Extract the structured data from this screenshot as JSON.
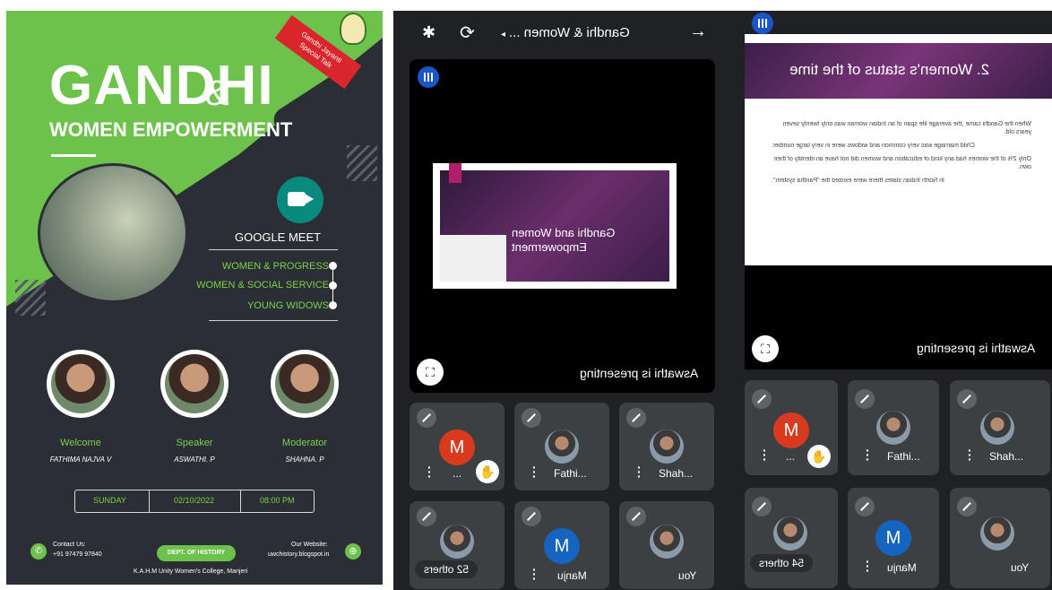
{
  "poster": {
    "title_line1": "GANDHI",
    "title_amp": "&",
    "title_line2": "WOMEN EMPOWERMENT",
    "tag_line1": "Gandhi Jayanti",
    "tag_line2": "Special Talk",
    "platform": "GOOGLE MEET",
    "topics": [
      "WOMEN & PROGRESS",
      "WOMEN & SOCIAL SERVICE",
      "YOUNG WIDOWS"
    ],
    "people": [
      {
        "role": "Welcome",
        "name": "FATHIMA NAJVA V"
      },
      {
        "role": "Speaker",
        "name": "ASWATHI. P"
      },
      {
        "role": "Moderator",
        "name": "SHAHNA. P"
      }
    ],
    "day": "SUNDAY",
    "date": "02/10/2022",
    "time": "08:00 PM",
    "contact_label": "Contact Us:",
    "contact_phone": "+91 97479 97840",
    "dept_badge": "DEPT. OF HISTORY",
    "website_label": "Our Website:",
    "website": "uwchistory.blogspot.in",
    "college": "K.A.H.M Unity Women's College, Manjeri",
    "colors": {
      "green": "#6cc24a",
      "dark": "#2b2e35"
    }
  },
  "meet1": {
    "meeting_title": "Gandhi & Women ...",
    "slide_title": "Gandhi and Women Empowerment",
    "presenting": "Aswathi is presenting",
    "tiles": [
      {
        "name": "...",
        "avatar": "M",
        "hand": true
      },
      {
        "name": "Fathi...",
        "photo": true
      },
      {
        "name": "Shah...",
        "photo": true
      },
      {
        "name": "52 others",
        "photo": true
      },
      {
        "name": "Manju",
        "avatar": "M"
      },
      {
        "name": "You",
        "photo": true
      }
    ],
    "icons": [
      "bluetooth-icon",
      "switch-camera-icon",
      "arrow-right-icon"
    ]
  },
  "meet2": {
    "slide_heading": "2. Women's status of the time",
    "bullets": [
      "When the Gandhi came ,the average life span of an Indian woman was only twenty seven years old.",
      "Child marriage was very common and widows were in very large number.",
      "Only 2% of the women had any kind of education and women did not have an identity of their own.",
      "In North Indian states there were existed the \"Pardha system\"."
    ],
    "presenting": "Aswathi is presenting",
    "tiles": [
      {
        "name": "...",
        "avatar": "M",
        "hand": true
      },
      {
        "name": "Fathi...",
        "photo": true
      },
      {
        "name": "Shah...",
        "photo": true
      },
      {
        "name": "54 others",
        "photo": true
      },
      {
        "name": "Manju",
        "avatar": "M"
      },
      {
        "name": "You",
        "photo": true
      }
    ]
  }
}
